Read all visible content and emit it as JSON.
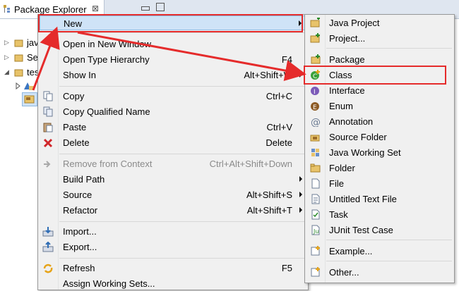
{
  "view": {
    "tab_title": "Package Explorer",
    "close_glyph": "⊠",
    "tree": [
      {
        "twist": "▷",
        "label": "jav",
        "icon": "java-project-icon"
      },
      {
        "twist": "▷",
        "label": "Se",
        "icon": "project-icon"
      },
      {
        "twist": "◢",
        "label": "tes",
        "icon": "project-icon"
      }
    ]
  },
  "menu": {
    "items": [
      {
        "label": "New",
        "accel": "",
        "submenu": true,
        "icon": ""
      },
      {
        "label": "Open in New Window",
        "accel": "",
        "icon": ""
      },
      {
        "label": "Open Type Hierarchy",
        "accel": "F4",
        "icon": ""
      },
      {
        "label": "Show In",
        "accel": "Alt+Shift+W",
        "submenu": true,
        "icon": ""
      },
      {
        "label": "Copy",
        "accel": "Ctrl+C",
        "icon": "copy-icon"
      },
      {
        "label": "Copy Qualified Name",
        "accel": "",
        "icon": "copy-qualified-name-icon"
      },
      {
        "label": "Paste",
        "accel": "Ctrl+V",
        "icon": "paste-icon"
      },
      {
        "label": "Delete",
        "accel": "Delete",
        "icon": "delete-icon"
      },
      {
        "label": "Remove from Context",
        "accel": "Ctrl+Alt+Shift+Down",
        "disabled": true,
        "icon": "remove-from-context-icon"
      },
      {
        "label": "Build Path",
        "accel": "",
        "submenu": true,
        "icon": ""
      },
      {
        "label": "Source",
        "accel": "Alt+Shift+S",
        "submenu": true,
        "icon": ""
      },
      {
        "label": "Refactor",
        "accel": "Alt+Shift+T",
        "submenu": true,
        "icon": ""
      },
      {
        "label": "Import...",
        "accel": "",
        "icon": "import-icon"
      },
      {
        "label": "Export...",
        "accel": "",
        "icon": "export-icon"
      },
      {
        "label": "Refresh",
        "accel": "F5",
        "icon": "refresh-icon"
      },
      {
        "label": "Assign Working Sets...",
        "accel": "",
        "icon": ""
      }
    ]
  },
  "submenu": {
    "items": [
      {
        "label": "Java Project",
        "icon": "java-project-icon"
      },
      {
        "label": "Project...",
        "icon": "project-icon"
      },
      {
        "label": "Package",
        "icon": "package-icon"
      },
      {
        "label": "Class",
        "icon": "class-icon"
      },
      {
        "label": "Interface",
        "icon": "interface-icon"
      },
      {
        "label": "Enum",
        "icon": "enum-icon"
      },
      {
        "label": "Annotation",
        "icon": "annotation-icon"
      },
      {
        "label": "Source Folder",
        "icon": "source-folder-icon"
      },
      {
        "label": "Java Working Set",
        "icon": "java-working-set-icon"
      },
      {
        "label": "Folder",
        "icon": "folder-icon"
      },
      {
        "label": "File",
        "icon": "file-icon"
      },
      {
        "label": "Untitled Text File",
        "icon": "untitled-text-file-icon"
      },
      {
        "label": "Task",
        "icon": "task-icon"
      },
      {
        "label": "JUnit Test Case",
        "icon": "junit-test-case-icon"
      },
      {
        "label": "Example...",
        "icon": "example-icon"
      },
      {
        "label": "Other...",
        "icon": "other-icon"
      }
    ]
  },
  "colors": {
    "highlight": "#cfe3f7",
    "annotation_red": "#e52b2b"
  }
}
